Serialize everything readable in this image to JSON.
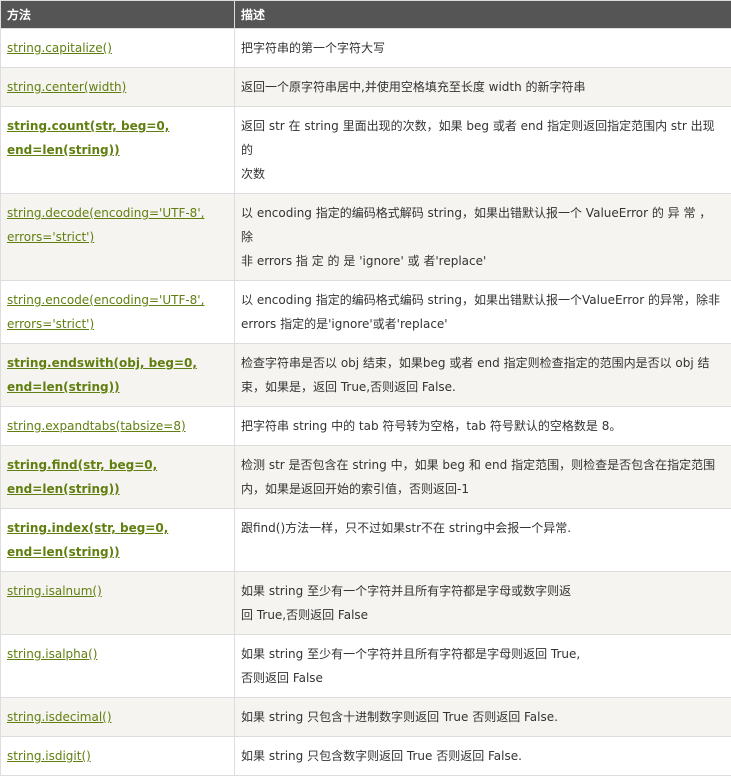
{
  "header": {
    "col_method": "方法",
    "col_desc": "描述"
  },
  "rows": [
    {
      "method": "string.capitalize()",
      "desc": [
        "把字符串的第一个字符大写"
      ]
    },
    {
      "method": "string.center(width)",
      "desc": [
        "返回一个原字符串居中,并使用空格填充至长度 width 的新字符串"
      ]
    },
    {
      "method_lines": [
        "string.count(str, beg=0,",
        "end=len(string))"
      ],
      "desc": [
        "返回 str 在 string 里面出现的次数，如果 beg 或者 end 指定则返回指定范围内 str 出现的",
        "次数"
      ]
    },
    {
      "method_lines": [
        "string.decode(encoding='UTF-8',",
        "errors='strict')"
      ],
      "desc": [
        "以 encoding 指定的编码格式解码 string，如果出错默认报一个 ValueError 的 异 常 ， 除",
        "非 errors 指 定 的 是 'ignore' 或 者'replace'"
      ]
    },
    {
      "method_lines": [
        "string.encode(encoding='UTF-8',",
        "errors='strict')"
      ],
      "desc": [
        "以 encoding 指定的编码格式编码 string，如果出错默认报一个ValueError 的异常，除非",
        "errors 指定的是'ignore'或者'replace'"
      ]
    },
    {
      "method_lines": [
        "string.endswith(obj, beg=0,",
        "end=len(string))"
      ],
      "desc": [
        "检查字符串是否以 obj 结束，如果beg 或者 end 指定则检查指定的范围内是否以 obj 结",
        "束，如果是，返回 True,否则返回 False."
      ]
    },
    {
      "method": "string.expandtabs(tabsize=8)",
      "desc": [
        "把字符串 string 中的 tab 符号转为空格，tab 符号默认的空格数是 8。"
      ]
    },
    {
      "method_lines": [
        "string.find(str, beg=0,",
        "end=len(string))"
      ],
      "desc": [
        "检测 str 是否包含在 string 中，如果 beg 和 end 指定范围，则检查是否包含在指定范围",
        "内，如果是返回开始的索引值，否则返回-1"
      ]
    },
    {
      "method_lines": [
        "string.index(str, beg=0,",
        "end=len(string))"
      ],
      "desc": [
        "跟find()方法一样，只不过如果str不在 string中会报一个异常."
      ]
    },
    {
      "method": "string.isalnum()",
      "desc": [
        "如果 string 至少有一个字符并且所有字符都是字母或数字则返",
        "回 True,否则返回 False"
      ]
    },
    {
      "method": "string.isalpha()",
      "desc": [
        "如果 string 至少有一个字符并且所有字符都是字母则返回 True,",
        "否则返回 False"
      ]
    },
    {
      "method": "string.isdecimal()",
      "desc": [
        "如果 string 只包含十进制数字则返回 True 否则返回 False."
      ]
    },
    {
      "method": "string.isdigit()",
      "desc": [
        "如果 string 只包含数字则返回 True 否则返回 False."
      ]
    }
  ]
}
